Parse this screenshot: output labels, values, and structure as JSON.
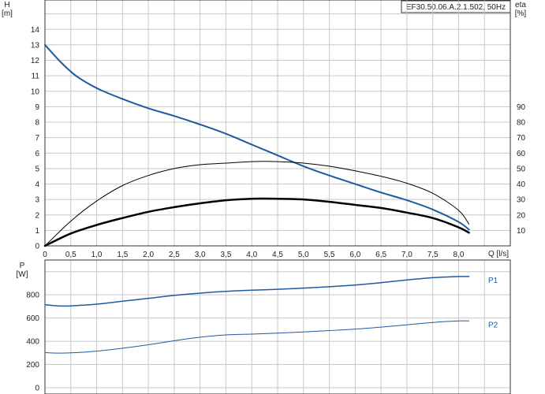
{
  "title": "EF30.50.06.A.2.1.502, 50Hz",
  "colors": {
    "grid": "#c8c8c8",
    "axis": "#333333",
    "blue": "#1f5aa0",
    "black": "#000000"
  },
  "chart_data": [
    {
      "type": "line",
      "panel": "head-efficiency",
      "xlabel": "Q [l/s]",
      "ylabel": "H",
      "yunit": "[m]",
      "y2label": "eta",
      "y2unit": "[%]",
      "xlim": [
        0,
        9.0
      ],
      "ylim": [
        0,
        15.9
      ],
      "y2lim": [
        0,
        159
      ],
      "grid": true,
      "xticks": [
        "0",
        "0,5",
        "1,0",
        "1,5",
        "2,0",
        "2,5",
        "3,0",
        "3,5",
        "4,0",
        "4,5",
        "5,0",
        "5,5",
        "6,0",
        "6,5",
        "7,0",
        "7,5",
        "8,0"
      ],
      "yticks": [
        "0",
        "1",
        "2",
        "3",
        "4",
        "5",
        "6",
        "7",
        "8",
        "9",
        "10",
        "11",
        "12",
        "13",
        "14"
      ],
      "y2ticks": [
        "10",
        "20",
        "30",
        "40",
        "50",
        "60",
        "70",
        "80",
        "90"
      ],
      "series": [
        {
          "color": "#1f5aa0",
          "width": 2,
          "axis": "left",
          "x": [
            0,
            0.3,
            0.6,
            1.0,
            1.5,
            2.0,
            2.5,
            3.0,
            3.5,
            4.0,
            4.5,
            5.0,
            5.5,
            6.0,
            6.5,
            7.0,
            7.5,
            8.0,
            8.2
          ],
          "y": [
            13.0,
            11.9,
            11.0,
            10.2,
            9.5,
            8.9,
            8.4,
            7.85,
            7.25,
            6.55,
            5.85,
            5.15,
            4.55,
            4.0,
            3.45,
            2.95,
            2.35,
            1.55,
            1.05
          ]
        },
        {
          "color": "#000000",
          "width": 1,
          "axis": "right",
          "x": [
            0,
            0.5,
            1.0,
            1.5,
            2.0,
            2.5,
            3.0,
            3.5,
            4.0,
            4.5,
            5.0,
            5.5,
            6.0,
            6.5,
            7.0,
            7.5,
            8.0,
            8.2
          ],
          "y": [
            0,
            16,
            29,
            39,
            45.5,
            50,
            52.5,
            53.5,
            54.5,
            54.5,
            53.5,
            51.5,
            48.5,
            45,
            40.5,
            34,
            23,
            14
          ]
        },
        {
          "color": "#000000",
          "width": 2.5,
          "axis": "left",
          "x": [
            0,
            0.5,
            1.0,
            1.5,
            2.0,
            2.5,
            3.0,
            3.5,
            4.0,
            4.5,
            5.0,
            5.5,
            6.0,
            6.5,
            7.0,
            7.5,
            8.0,
            8.2
          ],
          "y": [
            0,
            0.8,
            1.35,
            1.8,
            2.2,
            2.5,
            2.75,
            2.95,
            3.05,
            3.05,
            3.0,
            2.85,
            2.65,
            2.45,
            2.15,
            1.8,
            1.2,
            0.85
          ]
        }
      ]
    },
    {
      "type": "line",
      "panel": "power",
      "ylabel": "P",
      "yunit": "[W]",
      "xlim": [
        0,
        9.0
      ],
      "ylim": [
        0,
        1100
      ],
      "grid": true,
      "yticks": [
        "0",
        "200",
        "400",
        "600",
        "800"
      ],
      "series": [
        {
          "name": "P1",
          "color": "#1f5aa0",
          "width": 1.5,
          "x": [
            0,
            0.25,
            0.5,
            1.0,
            1.5,
            2.0,
            2.5,
            3.0,
            3.5,
            4.0,
            4.5,
            5.0,
            5.5,
            6.0,
            6.5,
            7.0,
            7.5,
            8.0,
            8.2
          ],
          "y": [
            715,
            705,
            705,
            720,
            745,
            770,
            795,
            815,
            830,
            840,
            848,
            858,
            870,
            885,
            905,
            928,
            948,
            958,
            958
          ]
        },
        {
          "name": "P2",
          "color": "#1f5aa0",
          "width": 1,
          "x": [
            0,
            0.25,
            0.5,
            1.0,
            1.5,
            2.0,
            2.5,
            3.0,
            3.5,
            4.0,
            4.5,
            5.0,
            5.5,
            6.0,
            6.5,
            7.0,
            7.5,
            8.0,
            8.2
          ],
          "y": [
            302,
            298,
            300,
            315,
            340,
            370,
            405,
            435,
            455,
            462,
            470,
            480,
            492,
            505,
            522,
            542,
            562,
            575,
            575
          ]
        }
      ]
    }
  ]
}
